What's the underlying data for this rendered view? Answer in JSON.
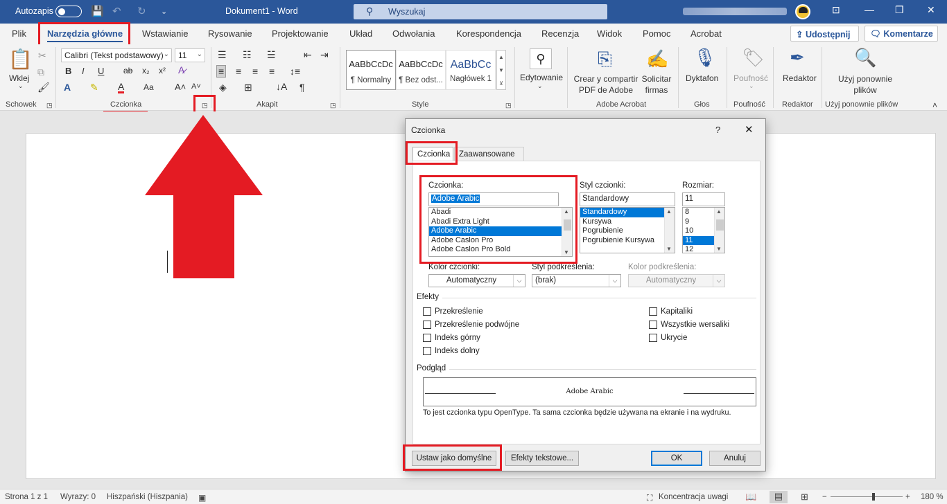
{
  "titlebar": {
    "autosave_label": "Autozapis",
    "document_title": "Dokument1 - Word",
    "search_placeholder": "Wyszukaj"
  },
  "tabs": [
    "Plik",
    "Narzędzia główne",
    "Wstawianie",
    "Rysowanie",
    "Projektowanie",
    "Układ",
    "Odwołania",
    "Korespondencja",
    "Recenzja",
    "Widok",
    "Pomoc",
    "Acrobat"
  ],
  "share_label": "Udostępnij",
  "comments_label": "Komentarze",
  "ribbon": {
    "clipboard": {
      "paste": "Wklej",
      "label": "Schowek"
    },
    "font": {
      "name": "Calibri (Tekst podstawowy)",
      "size": "11",
      "label": "Czcionka"
    },
    "paragraph": {
      "label": "Akapit"
    },
    "styles": {
      "label": "Style",
      "items": [
        {
          "preview": "AaBbCcDc",
          "name": "¶ Normalny"
        },
        {
          "preview": "AaBbCcDc",
          "name": "¶ Bez odst..."
        },
        {
          "preview": "AaBbCc",
          "name": "Nagłówek 1"
        }
      ]
    },
    "editing": {
      "label": "Edytowanie"
    },
    "acrobat": {
      "create": "Crear y compartir PDF de Adobe",
      "sign": "Solicitar firmas",
      "label": "Adobe Acrobat"
    },
    "voice": {
      "dictate": "Dyktafon",
      "label": "Głos"
    },
    "sensitivity": {
      "button": "Poufność",
      "label": "Poufność"
    },
    "editor": {
      "button": "Redaktor",
      "label": "Redaktor"
    },
    "reuse": {
      "button": "Użyj ponownie plików",
      "label": "Użyj ponownie plików"
    }
  },
  "dialog": {
    "title": "Czcionka",
    "help": "?",
    "tabs": [
      "Czcionka",
      "Zaawansowane"
    ],
    "font_label": "Czcionka:",
    "font_value": "Adobe Arabic",
    "font_list": [
      "Abadi",
      "Abadi Extra Light",
      "Adobe Arabic",
      "Adobe Caslon Pro",
      "Adobe Caslon Pro Bold"
    ],
    "font_selected": "Adobe Arabic",
    "style_label": "Styl czcionki:",
    "style_value": "Standardowy",
    "style_list": [
      "Standardowy",
      "Kursywa",
      "Pogrubienie",
      "Pogrubienie Kursywa"
    ],
    "size_label": "Rozmiar:",
    "size_value": "11",
    "size_list": [
      "8",
      "9",
      "10",
      "11",
      "12"
    ],
    "color_label": "Kolor czcionki:",
    "color_value": "Automatyczny",
    "underline_label": "Styl podkreślenia:",
    "underline_value": "(brak)",
    "underline_color_label": "Kolor podkreślenia:",
    "underline_color_value": "Automatyczny",
    "effects_label": "Efekty",
    "effects_left": [
      "Przekreślenie",
      "Przekreślenie podwójne",
      "Indeks górny",
      "Indeks dolny"
    ],
    "effects_right": [
      "Kapitaliki",
      "Wszystkie wersaliki",
      "Ukrycie"
    ],
    "preview_label": "Podgląd",
    "preview_text": "Adobe Arabic",
    "note": "To jest czcionka typu OpenType. Ta sama czcionka będzie używana na ekranie i na wydruku.",
    "buttons": {
      "default": "Ustaw jako domyślne",
      "text_effects": "Efekty tekstowe...",
      "ok": "OK",
      "cancel": "Anuluj"
    }
  },
  "statusbar": {
    "page": "Strona 1 z 1",
    "words": "Wyrazy: 0",
    "language": "Hiszpański (Hiszpania)",
    "focus": "Koncentracja uwagi",
    "zoom": "180 %"
  },
  "colors": {
    "accent": "#2b579a",
    "highlight_red": "#e41b23",
    "selection": "#0078d7"
  }
}
